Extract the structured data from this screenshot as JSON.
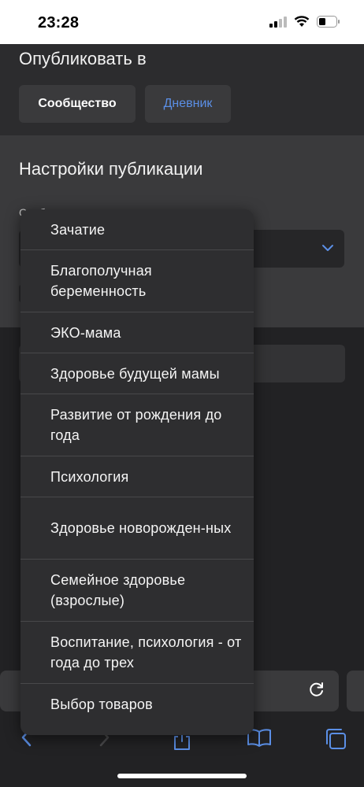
{
  "status_bar": {
    "time": "23:28"
  },
  "publish": {
    "title": "Опубликовать в",
    "tabs": [
      {
        "label": "Сообщество",
        "selected": true
      },
      {
        "label": "Дневник",
        "selected": false
      }
    ]
  },
  "settings": {
    "title": "Настройки публикации",
    "field_label": "Сооб"
  },
  "dropdown": {
    "options": [
      "Зачатие",
      "Благополучная беременность",
      "ЭКО-мама",
      "Здоровье будущей мамы",
      "Развитие от рождения до года",
      "Психология",
      "Здоровье новорожден-ных",
      "Семейное здоровье (взрослые)",
      "Воспитание, психология - от года до трех",
      "Выбор товаров"
    ]
  },
  "colors": {
    "accent": "#5b8fe6",
    "background": "#1c1c1e",
    "menu_bg": "#2e2e30"
  },
  "icons": [
    "signal-icon",
    "wifi-icon",
    "battery-icon",
    "chevron-down-icon",
    "reload-icon",
    "back-icon",
    "forward-icon",
    "share-icon",
    "bookmarks-icon",
    "tabs-icon"
  ]
}
